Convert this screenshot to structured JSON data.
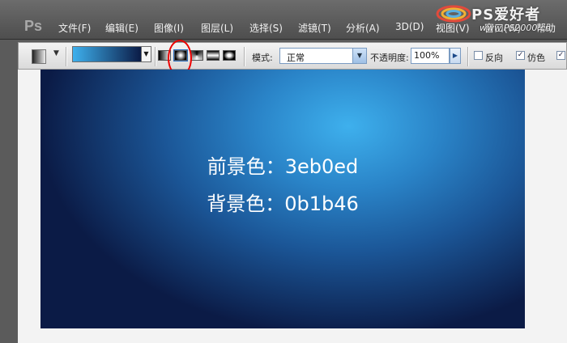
{
  "app": {
    "logo": "Ps"
  },
  "menu": {
    "items": [
      "文件(F)",
      "编辑(E)",
      "图像(I)",
      "图层(L)",
      "选择(S)",
      "滤镜(T)",
      "分析(A)",
      "3D(D)",
      "视图(V)",
      "窗口(W)",
      "帮助"
    ]
  },
  "watermark": {
    "text": "PS爱好者",
    "url": "www.PS2000.cn"
  },
  "options": {
    "gradient_colors": [
      "#3eb0ed",
      "#0b1b46"
    ],
    "gradient_types": [
      "linear-gradient-icon",
      "radial-gradient-icon",
      "angle-gradient-icon",
      "reflected-gradient-icon",
      "diamond-gradient-icon"
    ],
    "active_type_index": 1,
    "mode_label": "模式:",
    "mode_value": "正常",
    "opacity_label": "不透明度:",
    "opacity_value": "100%",
    "reverse_label": "反向",
    "reverse_checked": false,
    "dither_label": "仿色",
    "dither_checked": true,
    "transparency_checked": true
  },
  "canvas": {
    "foreground": "前景色：3eb0ed",
    "background": "背景色：0b1b46"
  },
  "colors": {
    "foreground": "#3eb0ed",
    "background": "#0b1b46",
    "highlight": "#e00000"
  }
}
